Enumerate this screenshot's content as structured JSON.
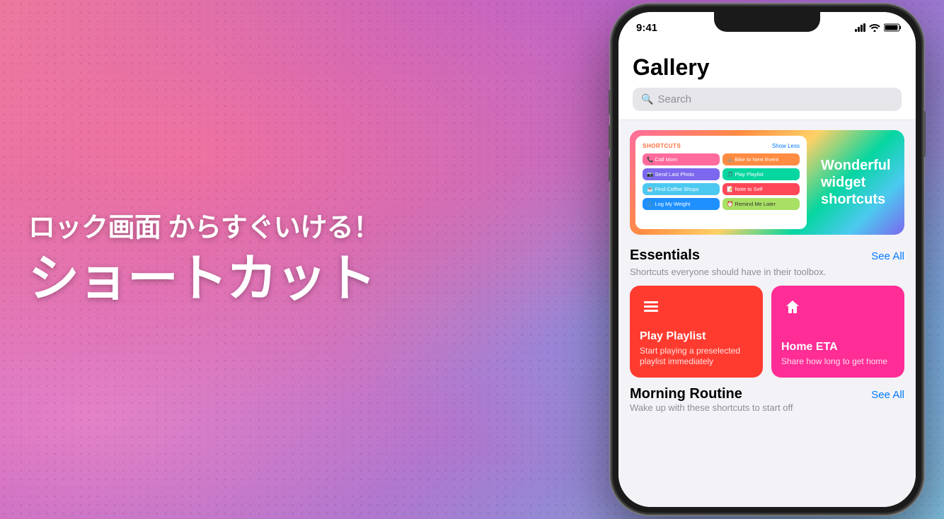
{
  "background": {
    "alt": "colorful gradient background with dot pattern"
  },
  "left_text": {
    "subtitle": "ロック画面 からすぐいける！",
    "main_title": "ショートカット"
  },
  "phone": {
    "status_bar": {
      "time": "9:41",
      "icons": [
        "signal",
        "wifi",
        "battery"
      ]
    },
    "gallery": {
      "title": "Gallery",
      "search": {
        "placeholder": "Search"
      },
      "widget_banner": {
        "shortcuts_label": "SHORTCUTS",
        "show_less": "Show Less",
        "items": [
          {
            "label": "Call Mom",
            "color": "pink"
          },
          {
            "label": "Bike to Next Event",
            "color": "orange"
          },
          {
            "label": "Send Last Photo",
            "color": "purple"
          },
          {
            "label": "Play Playlist",
            "color": "green"
          },
          {
            "label": "Find Coffee Shops",
            "color": "teal"
          },
          {
            "label": "Note to Self",
            "color": "red"
          },
          {
            "label": "Log My Weight",
            "color": "blue"
          },
          {
            "label": "Remind Me Later",
            "color": "yellow-green"
          }
        ],
        "right_text": "Wonderful widget shortcuts"
      },
      "essentials": {
        "title": "Essentials",
        "see_all": "See All",
        "description": "Shortcuts everyone should have in their toolbox.",
        "cards": [
          {
            "title": "Play Playlist",
            "description": "Start playing a preselected playlist immediately",
            "icon": "list",
            "color": "red"
          },
          {
            "title": "Home ETA",
            "description": "Share how long to get home",
            "icon": "home",
            "color": "pink"
          }
        ]
      },
      "morning_routine": {
        "title": "Morning Routine",
        "see_all": "See All",
        "description": "Wake up with these shortcuts to start off"
      }
    }
  }
}
